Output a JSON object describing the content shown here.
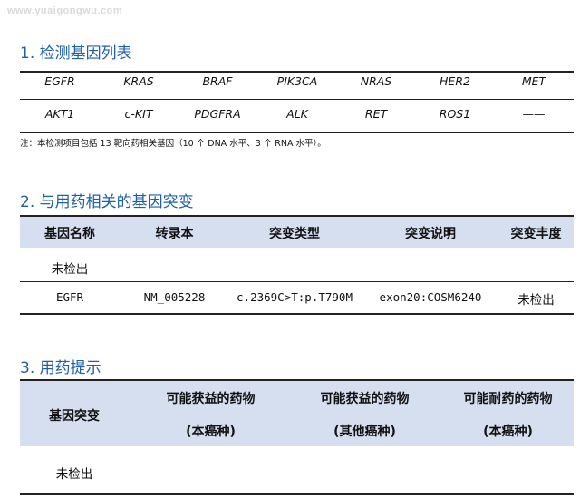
{
  "watermark": "www.yuaigongwu.com",
  "section1": {
    "title": "1. 检测基因列表",
    "genes_row1": [
      "EGFR",
      "KRAS",
      "BRAF",
      "PIK3CA",
      "NRAS",
      "HER2",
      "MET"
    ],
    "genes_row2": [
      "AKT1",
      "c-KIT",
      "PDGFRA",
      "ALK",
      "RET",
      "ROS1",
      "——"
    ],
    "note": "注：本检测项目包括 13 靶向药相关基因（10 个 DNA 水平、3 个 RNA 水平）。"
  },
  "section2": {
    "title": "2. 与用药相关的基因突变",
    "headers": [
      "基因名称",
      "转录本",
      "突变类型",
      "突变说明",
      "突变丰度"
    ],
    "not_detected": "未检出",
    "row": {
      "gene": "EGFR",
      "transcript": "NM_005228",
      "mutation_type": "c.2369C>T:p.T790M",
      "mutation_desc": "exon20:COSM6240",
      "abundance": "未检出"
    }
  },
  "section3": {
    "title": "3. 用药提示",
    "header_gene": "基因突变",
    "col2": {
      "line1": "可能获益的药物",
      "line2": "(本癌种)"
    },
    "col3": {
      "line1": "可能获益的药物",
      "line2": "(其他癌种)"
    },
    "col4": {
      "line1": "可能耐药的药物",
      "line2": "(本癌种)"
    },
    "not_detected": "未检出"
  }
}
